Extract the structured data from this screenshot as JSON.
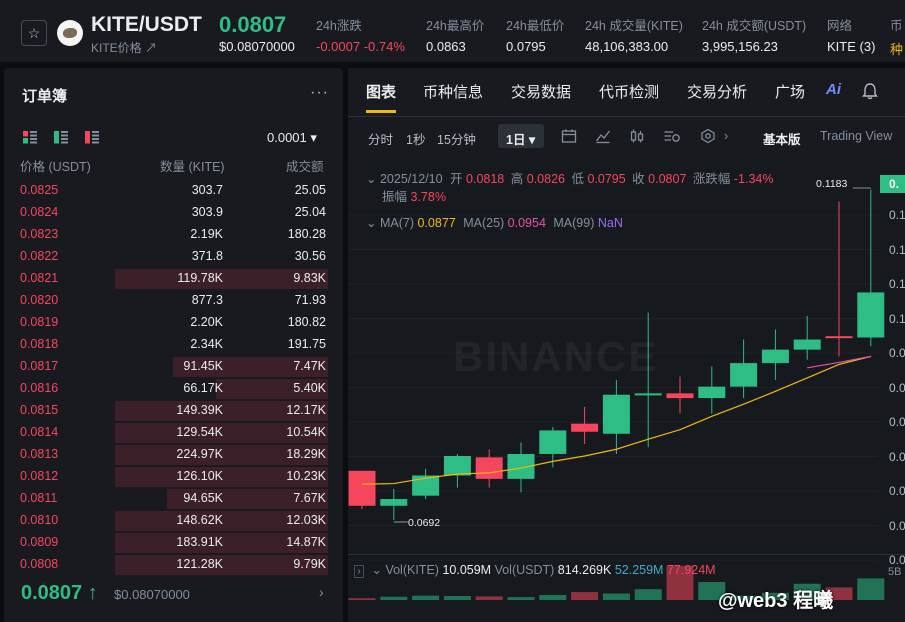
{
  "header": {
    "pair": "KITE/USDT",
    "pair_sub": "KITE价格 ↗",
    "price": "0.0807",
    "price_usd": "$0.08070000",
    "stats": [
      {
        "label": "24h涨跌",
        "value": "-0.0007 -0.74%",
        "tone": "red"
      },
      {
        "label": "24h最高价",
        "value": "0.0863",
        "tone": "normal"
      },
      {
        "label": "24h最低价",
        "value": "0.0795",
        "tone": "normal"
      },
      {
        "label": "24h 成交量(KITE)",
        "value": "48,106,383.00",
        "tone": "normal"
      },
      {
        "label": "24h 成交额(USDT)",
        "value": "3,995,156.23",
        "tone": "normal"
      },
      {
        "label": "网络",
        "value": "KITE (3)",
        "tone": "normal"
      },
      {
        "label": "币",
        "value": "种",
        "tone": "yellow"
      }
    ]
  },
  "orderbook": {
    "title": "订单簿",
    "more": "···",
    "precision": "0.0001 ▾",
    "columns": [
      "价格 (USDT)",
      "数量 (KITE)",
      "成交额"
    ],
    "asks": [
      {
        "price": "0.0825",
        "qty": "303.7",
        "total": "25.05",
        "depth": 0
      },
      {
        "price": "0.0824",
        "qty": "303.9",
        "total": "25.04",
        "depth": 0
      },
      {
        "price": "0.0823",
        "qty": "2.19K",
        "total": "180.28",
        "depth": 0
      },
      {
        "price": "0.0822",
        "qty": "371.8",
        "total": "30.56",
        "depth": 0
      },
      {
        "price": "0.0821",
        "qty": "119.78K",
        "total": "9.83K",
        "depth": 0.95
      },
      {
        "price": "0.0820",
        "qty": "877.3",
        "total": "71.93",
        "depth": 0
      },
      {
        "price": "0.0819",
        "qty": "2.20K",
        "total": "180.82",
        "depth": 0
      },
      {
        "price": "0.0818",
        "qty": "2.34K",
        "total": "191.75",
        "depth": 0
      },
      {
        "price": "0.0817",
        "qty": "91.45K",
        "total": "7.47K",
        "depth": 0.69
      },
      {
        "price": "0.0816",
        "qty": "66.17K",
        "total": "5.40K",
        "depth": 0.5
      },
      {
        "price": "0.0815",
        "qty": "149.39K",
        "total": "12.17K",
        "depth": 0.95
      },
      {
        "price": "0.0814",
        "qty": "129.54K",
        "total": "10.54K",
        "depth": 0.95
      },
      {
        "price": "0.0813",
        "qty": "224.97K",
        "total": "18.29K",
        "depth": 0.95
      },
      {
        "price": "0.0812",
        "qty": "126.10K",
        "total": "10.23K",
        "depth": 0.95
      },
      {
        "price": "0.0811",
        "qty": "94.65K",
        "total": "7.67K",
        "depth": 0.72
      },
      {
        "price": "0.0810",
        "qty": "148.62K",
        "total": "12.03K",
        "depth": 0.95
      },
      {
        "price": "0.0809",
        "qty": "183.91K",
        "total": "14.87K",
        "depth": 0.95
      },
      {
        "price": "0.0808",
        "qty": "121.28K",
        "total": "9.79K",
        "depth": 0.95
      }
    ],
    "mid_price": "0.0807",
    "mid_arrow": "↑",
    "mid_usd": "$0.08070000",
    "mid_nav": "›"
  },
  "chart_panel": {
    "tabs": [
      "图表",
      "币种信息",
      "交易数据",
      "代币检测",
      "交易分析",
      "广场"
    ],
    "active_tab": 0,
    "ai_label": "Ai",
    "toolbar": {
      "time_label": "分时",
      "intervals": [
        "1秒",
        "15分钟",
        "1日 ▾"
      ],
      "basic_label": "基本版",
      "tv_label": "Trading View"
    },
    "ohlc_line": {
      "date": "2025/12/10",
      "open_label": "开",
      "open": "0.0818",
      "high_label": "高",
      "high": "0.0826",
      "low_label": "低",
      "low": "0.0795",
      "close_label": "收",
      "close": "0.0807",
      "change_label": "涨跌幅",
      "change": "-1.34%",
      "amp_label": "振幅",
      "amp": "3.78%"
    },
    "ma_line": {
      "ma7_label": "MA(7)",
      "ma7": "0.0877",
      "ma25_label": "MA(25)",
      "ma25": "0.0954",
      "ma99_label": "MA(99)",
      "ma99": "NaN"
    },
    "high_marker": "0.1183",
    "low_marker": "0.0692",
    "vol_line": {
      "vol_kite_label": "Vol(KITE)",
      "vol_kite": "10.059M",
      "vol_usdt_label": "Vol(USDT)",
      "vol_usdt": "814.269K",
      "v1": "52.259M",
      "v2": "77.924M"
    },
    "axis_labels": [
      "0.1",
      "0.1",
      "0.1",
      "0.1",
      "0.0",
      "0.0",
      "0.0",
      "0.0",
      "0.0",
      "0.0",
      "0.0"
    ],
    "vol_axis_label": "5B",
    "watermark": "BINANCE",
    "overlay_text": "@web3 程曦"
  },
  "chart_data": {
    "type": "candlestick",
    "candles": [
      {
        "o": 0.0765,
        "h": 0.0765,
        "l": 0.0708,
        "c": 0.0713
      },
      {
        "o": 0.0713,
        "h": 0.0738,
        "l": 0.0692,
        "c": 0.0723
      },
      {
        "o": 0.0728,
        "h": 0.0768,
        "l": 0.0723,
        "c": 0.0758
      },
      {
        "o": 0.0758,
        "h": 0.079,
        "l": 0.074,
        "c": 0.0787
      },
      {
        "o": 0.0785,
        "h": 0.0797,
        "l": 0.074,
        "c": 0.0753
      },
      {
        "o": 0.0753,
        "h": 0.0807,
        "l": 0.0733,
        "c": 0.079
      },
      {
        "o": 0.079,
        "h": 0.083,
        "l": 0.077,
        "c": 0.0825
      },
      {
        "o": 0.0835,
        "h": 0.086,
        "l": 0.0805,
        "c": 0.0823
      },
      {
        "o": 0.082,
        "h": 0.09,
        "l": 0.079,
        "c": 0.0878
      },
      {
        "o": 0.088,
        "h": 0.1,
        "l": 0.08,
        "c": 0.088
      },
      {
        "o": 0.088,
        "h": 0.0905,
        "l": 0.085,
        "c": 0.0873
      },
      {
        "o": 0.0873,
        "h": 0.092,
        "l": 0.085,
        "c": 0.089
      },
      {
        "o": 0.089,
        "h": 0.096,
        "l": 0.0873,
        "c": 0.0925
      },
      {
        "o": 0.0925,
        "h": 0.0975,
        "l": 0.09,
        "c": 0.0945
      },
      {
        "o": 0.0945,
        "h": 0.0995,
        "l": 0.093,
        "c": 0.096
      },
      {
        "o": 0.0965,
        "h": 0.1165,
        "l": 0.0935,
        "c": 0.0963
      },
      {
        "o": 0.0963,
        "h": 0.1183,
        "l": 0.095,
        "c": 0.103
      }
    ],
    "volumes": [
      0.05,
      0.09,
      0.12,
      0.11,
      0.1,
      0.08,
      0.14,
      0.22,
      0.18,
      0.3,
      0.95,
      0.5,
      0.12,
      0.2,
      0.45,
      0.35,
      0.6
    ],
    "ma7": [
      0.0745,
      0.0746,
      0.0754,
      0.076,
      0.0762,
      0.0769,
      0.0779,
      0.0787,
      0.0797,
      0.0812,
      0.0826,
      0.0846,
      0.0864,
      0.0883,
      0.0903,
      0.0923,
      0.0935
    ],
    "ma25": [
      0.0918,
      0.0926,
      0.0935
    ]
  }
}
